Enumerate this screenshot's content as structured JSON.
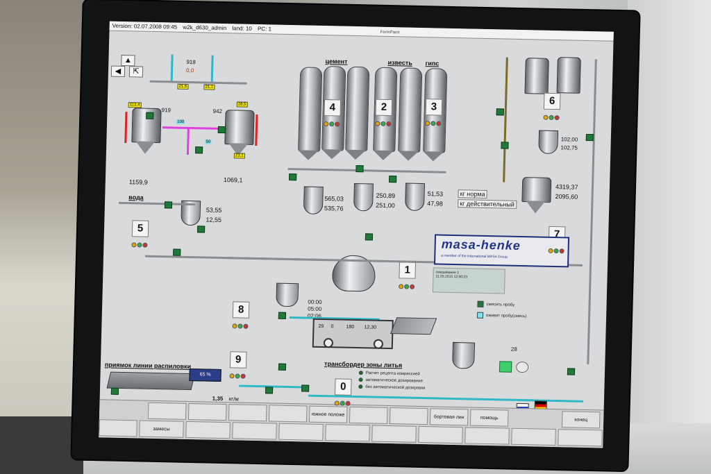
{
  "topbar": {
    "version": "Version: 02.07.2008 09:45",
    "user": "w2k_d630_admin",
    "land": "land: 10",
    "pc": "PC: 1",
    "formpaint": "FormPaint"
  },
  "nav": {
    "back_icon": "arrow-left-icon",
    "up_icon": "arrow-up-icon"
  },
  "materials": {
    "cement": "цемент",
    "lime": "известь",
    "gypsum": "гипс",
    "water": "вода"
  },
  "sections": {
    "box4": "4",
    "box2": "2",
    "box3": "3",
    "box6": "6",
    "box5": "5",
    "box7": "7",
    "box1": "1",
    "box8": "8",
    "box9": "9",
    "box0": "0"
  },
  "values": {
    "top_918": "918",
    "top_0_0": "0,0",
    "left_tank_weight": "1159,9",
    "right_tank_weight": "1069,1",
    "left_tank_919": "919",
    "right_tank_942": "942",
    "water_actual": "53,55",
    "water_target": "12,55",
    "cement_actual": "565,03",
    "cement_target": "535,76",
    "lime_actual": "250,89",
    "lime_target": "251,00",
    "gypsum_actual": "51,53",
    "gypsum_target": "47,98",
    "right_102": "102,00",
    "right_102_75": "102,75",
    "right_4319": "4319,37",
    "right_2095": "2095,60",
    "conveyor_135": "1,35",
    "saw_65": "65",
    "truck_cells": [
      "29",
      "0",
      "180",
      "12,30"
    ],
    "dosing_28": "28",
    "times": [
      "00:00",
      "05:00",
      "02:06"
    ]
  },
  "labels": {
    "kg_norm": "кг норма",
    "kg_actual": "кг действительный",
    "transborder": "трансбордер зоны литья",
    "saw_line": "приямок линии распиловки",
    "kg_min": "кг/м"
  },
  "logo": {
    "name": "masa-henke",
    "tagline": "a member of the international MASA Group"
  },
  "legend": [
    "смесить пробу",
    "оживит пробу(смесь)"
  ],
  "status_list": [
    "Расчет рецепта комрессией",
    "автоматическое дозирование",
    "без автоматической дозировки"
  ],
  "infobox": [
    "смешивание 1",
    "11.05.2015 12:00:23"
  ],
  "func_keys_top": [
    "",
    "",
    "",
    "",
    "южное положе",
    "",
    "",
    "бортовая лин",
    "помощь",
    "",
    "",
    "конец"
  ],
  "func_keys_bottom": [
    "",
    "замесы",
    "",
    "",
    "",
    "",
    "",
    "",
    "",
    "",
    ""
  ],
  "flags": [
    "ru-flag",
    "de-flag"
  ],
  "colors": {
    "valve_green": "#1f7a3a",
    "accent_cyan": "#30b8c8",
    "pipe_magenta": "#e040e0",
    "logo_blue": "#21328a",
    "highlight_yellow": "#f6e800"
  }
}
